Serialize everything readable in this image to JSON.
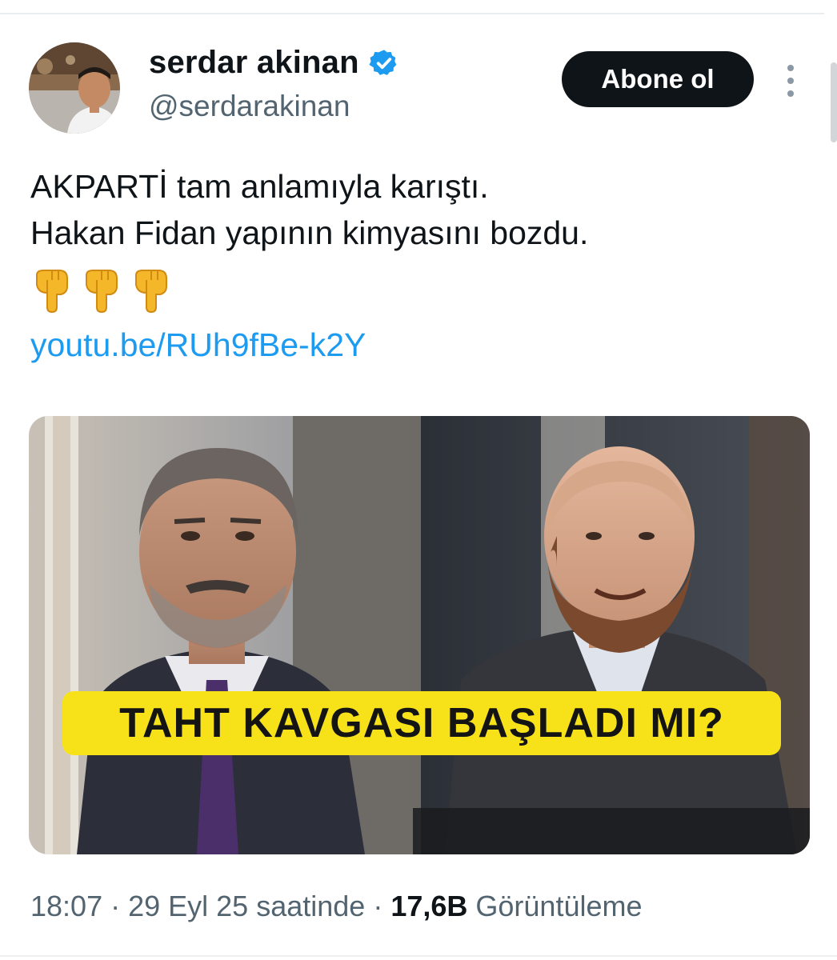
{
  "author": {
    "display_name": "serdar akinan",
    "handle": "@serdarakinan",
    "verified": true
  },
  "actions": {
    "follow_label": "Abone ol",
    "more_icon": "more-vertical-icon"
  },
  "tweet": {
    "lines": [
      "AKPARTİ tam anlamıyla karıştı.",
      "Hakan Fidan yapının kimyasını bozdu."
    ],
    "emoji_icon": "pointing-down-icon",
    "emoji_count": 3,
    "link": "youtu.be/RUh9fBe-k2Y"
  },
  "media": {
    "banner_text": "TAHT KAVGASI BAŞLADI MI?"
  },
  "meta": {
    "time": "18:07",
    "sep1": " · ",
    "date": "29 Eyl 25 saatinde",
    "sep2": " · ",
    "views": "17,6B",
    "views_label": " Görüntüleme"
  },
  "colors": {
    "text": "#0f1419",
    "secondary": "#536471",
    "link": "#1d9bf0",
    "verified": "#1d9bf0",
    "banner": "#f7e21a"
  }
}
